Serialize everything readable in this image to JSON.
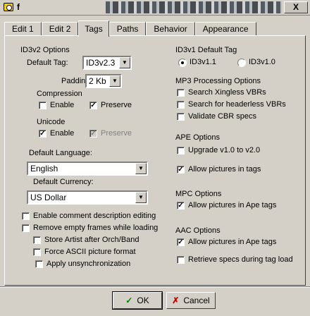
{
  "window": {
    "title": "f",
    "close_glyph": "X"
  },
  "tabs": [
    {
      "label": "Edit 1"
    },
    {
      "label": "Edit 2"
    },
    {
      "label": "Tags"
    },
    {
      "label": "Paths"
    },
    {
      "label": "Behavior"
    },
    {
      "label": "Appearance"
    }
  ],
  "id3v2": {
    "heading": "ID3v2 Options",
    "default_tag_label": "Default Tag:",
    "default_tag_value": "ID3v2.3",
    "padding_label": "Padding:",
    "padding_value": "2 Kb",
    "compression_label": "Compression",
    "compression_enable": {
      "label": "Enable",
      "checked": false
    },
    "compression_preserve": {
      "label": "Preserve",
      "checked": true
    },
    "unicode_label": "Unicode",
    "unicode_enable": {
      "label": "Enable",
      "checked": true
    },
    "unicode_preserve": {
      "label": "Preserve",
      "checked": true,
      "disabled": true
    }
  },
  "language": {
    "label": "Default Language:",
    "value": "English"
  },
  "currency": {
    "label": "Default Currency:",
    "value": "US Dollar"
  },
  "options": [
    {
      "label": "Enable comment description editing",
      "checked": false
    },
    {
      "label": "Remove empty frames while loading",
      "checked": false
    },
    {
      "label": "Store Artist after Orch/Band",
      "checked": false
    },
    {
      "label": "Force ASCII picture format",
      "checked": false
    },
    {
      "label": "Apply unsynchronization",
      "checked": false
    }
  ],
  "id3v1": {
    "heading": "ID3v1 Default Tag",
    "v11": {
      "label": "ID3v1.1",
      "selected": true
    },
    "v10": {
      "label": "ID3v1.0",
      "selected": false
    }
  },
  "mp3": {
    "heading": "MP3 Processing Options",
    "items": [
      {
        "label": "Search Xingless VBRs",
        "checked": false
      },
      {
        "label": "Search for headerless VBRs",
        "checked": false
      },
      {
        "label": "Validate CBR specs",
        "checked": false
      }
    ]
  },
  "ape": {
    "heading": "APE Options",
    "items": [
      {
        "label": "Upgrade v1.0 to v2.0",
        "checked": false
      },
      {
        "label": "Allow pictures in tags",
        "checked": true
      }
    ]
  },
  "mpc": {
    "heading": "MPC Options",
    "items": [
      {
        "label": "Allow pictures in Ape tags",
        "checked": true
      }
    ]
  },
  "aac": {
    "heading": "AAC Options",
    "items": [
      {
        "label": "Allow pictures in Ape tags",
        "checked": true
      },
      {
        "label": "Retrieve specs during tag load",
        "checked": false
      }
    ]
  },
  "buttons": {
    "ok": "OK",
    "cancel": "Cancel",
    "ok_icon": "check-icon",
    "cancel_icon": "x-icon"
  },
  "check_glyph": "✓"
}
